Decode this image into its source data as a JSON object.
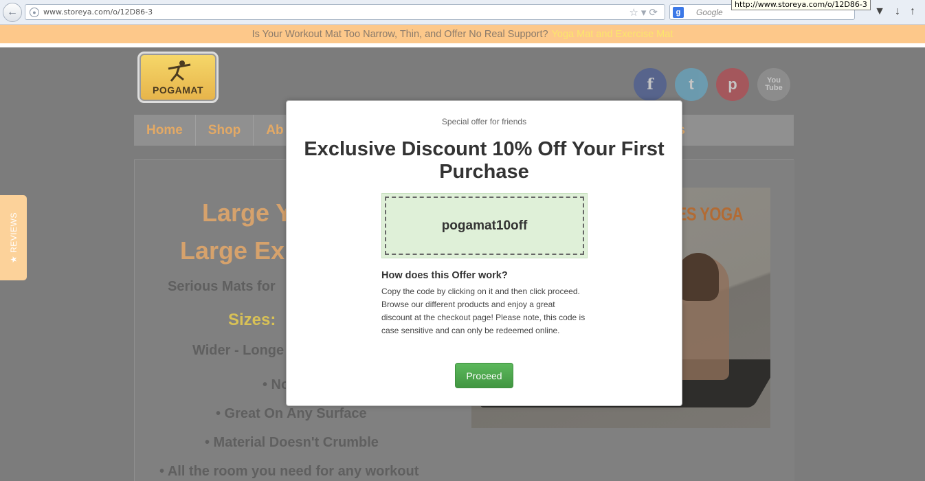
{
  "browser": {
    "url": "www.storeya.com/o/12D86-3",
    "search_placeholder": "Google",
    "search_engine_badge": "g",
    "tooltip": "http://www.storeya.com/o/12D86-3"
  },
  "announcement": {
    "text": "Is Your Workout Mat Too Narrow, Thin, and Offer No Real Support?",
    "link": "Yoga Mat and Exercise Mat"
  },
  "logo": {
    "text": "POGAMAT"
  },
  "socials": {
    "facebook": "f",
    "twitter": "t",
    "pinterest": "p",
    "youtube_line1": "You",
    "youtube_line2": "Tube"
  },
  "nav": {
    "home": "Home",
    "shop": "Shop",
    "about": "Ab",
    "right_fragment": "s"
  },
  "content": {
    "title_line1": "Large Y",
    "title_line2": "Large Ex",
    "subtitle": "Serious Mats for",
    "sizes": "Sizes:",
    "wider": "Wider - Longe",
    "bullets": [
      "• No",
      "• Great On Any Surface",
      "• Material Doesn't Crumble",
      "• All the room you need for any workout"
    ],
    "photo_title": "UPLES YOGA"
  },
  "reviews_tab": {
    "label": "★ REVIEWS"
  },
  "modal": {
    "pre_title": "Special offer for friends",
    "title": "Exclusive Discount 10% Off Your First Purchase",
    "code": "pogamat10off",
    "how_title": "How does this Offer work?",
    "how_text": "Copy the code by clicking on it and then click proceed. Browse our different products and enjoy a great discount at the checkout page! Please note, this code is case sensitive and can only be redeemed online.",
    "proceed_label": "Proceed"
  },
  "colors": {
    "announce_bg": "#fdc88a",
    "overlay": "#7c7c7c",
    "proceed": "#5cb85c",
    "coupon_bg": "#dff0d8"
  }
}
